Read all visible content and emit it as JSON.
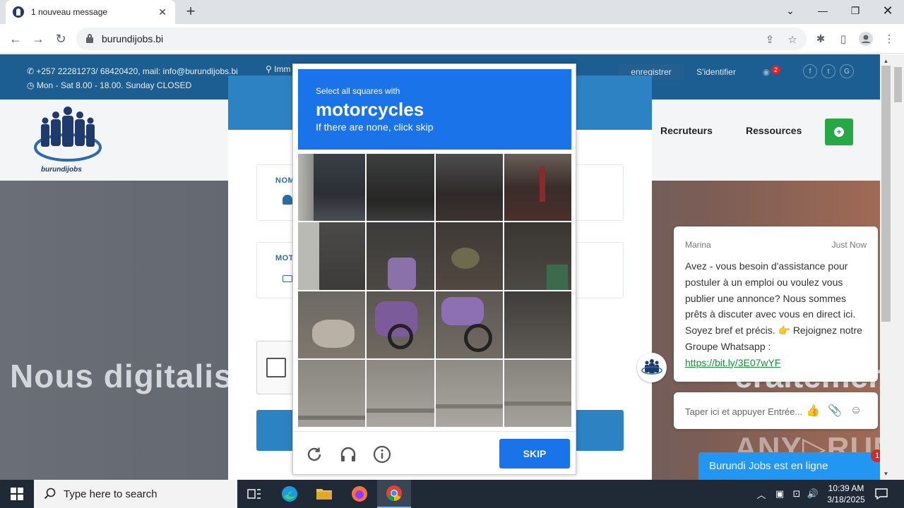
{
  "browser": {
    "tab_title": "1 nouveau message",
    "tab_close": "✕",
    "new_tab": "+",
    "url": "burundijobs.bi"
  },
  "site": {
    "contact_line1": "+257 22281273/ 68420420, mail: info@burundijobs.bi",
    "contact_line2": "Mon - Sat 8.00 - 18.00. Sunday CLOSED",
    "address_partial": "Imm",
    "register": "enregistrer",
    "login": "S'identifier",
    "notif_count": "2",
    "social": [
      "f",
      "t",
      "G"
    ],
    "logo_text": "burundijobs",
    "nav": [
      "Recruteurs",
      "Ressources"
    ],
    "hero_left": "Nous digitalis",
    "hero_right": "eraitement",
    "login_fields": [
      "NOM",
      "MOT"
    ]
  },
  "captcha": {
    "prompt_pre": "Select all squares with",
    "target": "motorcycles",
    "prompt_sub": "If there are none, click skip",
    "skip_label": "SKIP"
  },
  "chat": {
    "agent_name": "Marina",
    "time": "Just Now",
    "message": "Avez - vous besoin d'assistance pour postuler à un emploi ou voulez vous publier une annonce? Nous sommes prêts à discuter avec vous en direct ici. Soyez bref et précis. 👉 Rejoignez notre Groupe Whatsapp :",
    "link": "https://bit.ly/3E07wYF",
    "input_placeholder": "Taper ici et appuyer Entrée...",
    "bar_label": "Burundi Jobs est en ligne",
    "badge": "1"
  },
  "watermark": "ANY▷RUN",
  "taskbar": {
    "search_placeholder": "Type here to search",
    "time": "10:39 AM",
    "date": "3/18/2025"
  }
}
